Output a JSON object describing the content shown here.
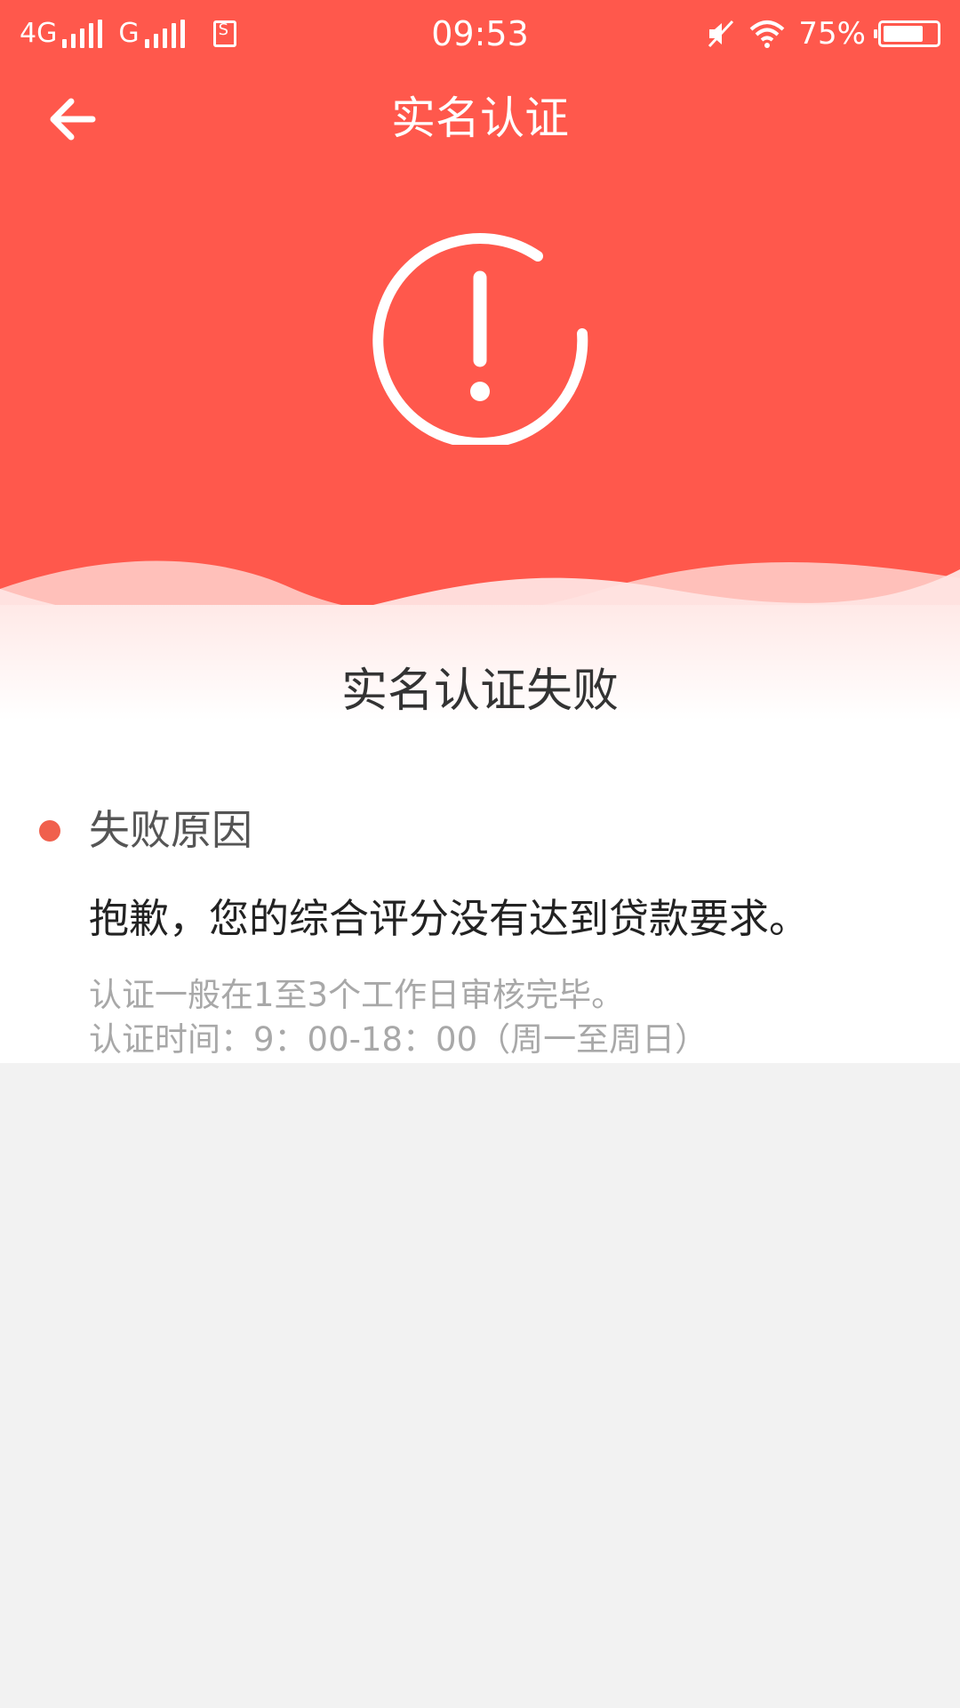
{
  "status_bar": {
    "network_1": "4G",
    "network_2": "G",
    "time": "09:53",
    "battery_percent": "75%",
    "battery_level": 0.75,
    "icons": [
      "signal-icon",
      "signal-icon",
      "sim-icon",
      "mute-icon",
      "wifi-icon",
      "battery-icon"
    ]
  },
  "nav": {
    "title": "实名认证",
    "back_icon": "arrow-left-icon"
  },
  "hero": {
    "icon": "exclamation-circle-icon",
    "color": "#ff584c"
  },
  "result": {
    "title": "实名认证失败"
  },
  "reason": {
    "label": "失败原因",
    "text": "抱歉，您的综合评分没有达到贷款要求。",
    "dot_color": "#f0604d"
  },
  "notes": {
    "line1": "认证一般在1至3个工作日审核完毕。",
    "line2": "认证时间：9：00-18：00（周一至周日）"
  }
}
